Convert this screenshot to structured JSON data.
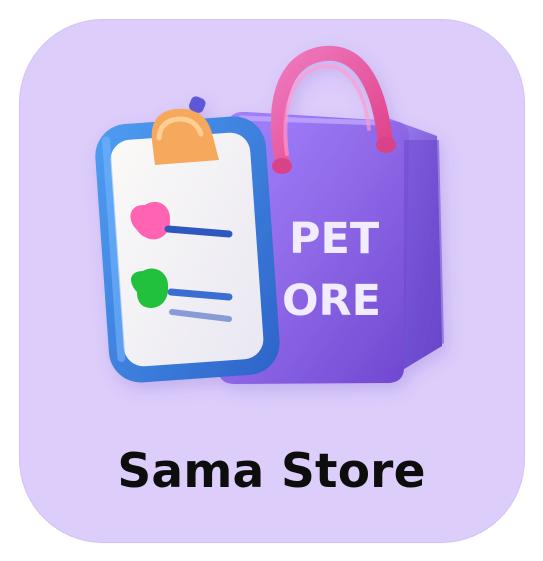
{
  "app": {
    "name": "Sama Store",
    "icon": "checklist-and-shopping-bag-icon",
    "bag_text_line1": "PET",
    "bag_text_line2": "ORE"
  },
  "colors": {
    "tile_background": "#dccdfb",
    "label": "#0d0d0d",
    "bag": "#8f69e8",
    "clipboard_frame": "#3f7ee2",
    "clipboard_clip": "#f6a85c",
    "handle": "#ef5aa3",
    "pink_bullet": "#ff63b1",
    "green_bullet": "#23c13d"
  }
}
